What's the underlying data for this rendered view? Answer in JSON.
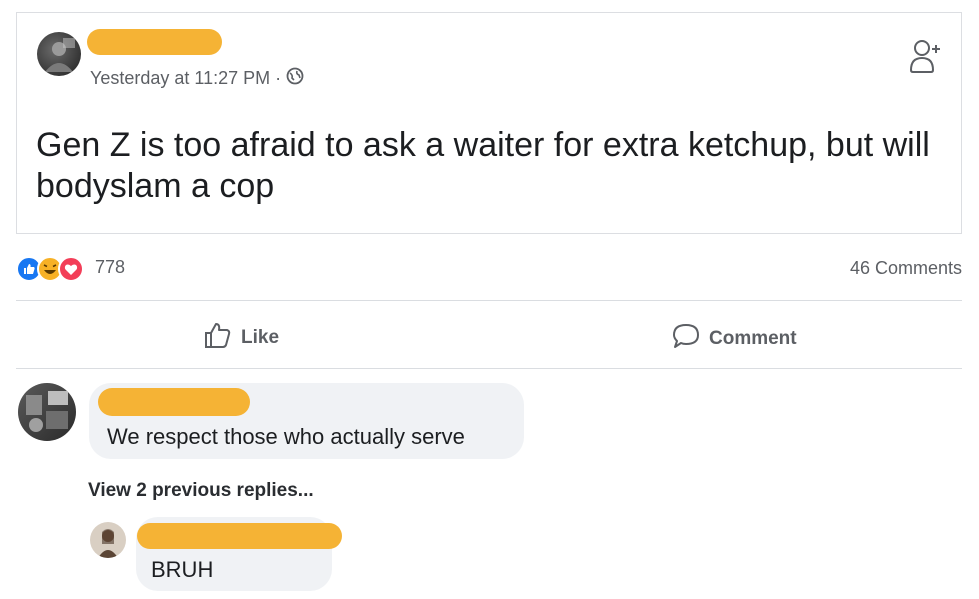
{
  "post": {
    "timestamp": "Yesterday at 11:27 PM",
    "separator": "·",
    "text": "Gen Z is too afraid to ask a waiter for extra ketchup, but will bodyslam a cop",
    "privacy_icon": "globe-icon",
    "add_friend_icon": "add-friend-icon"
  },
  "stats": {
    "reaction_count": "778",
    "reaction_icons": [
      "like-icon",
      "haha-icon",
      "love-icon"
    ],
    "comments_count": "46 Comments"
  },
  "actions": {
    "like_label": "Like",
    "comment_label": "Comment"
  },
  "comments": [
    {
      "text": "We respect those who actually serve"
    }
  ],
  "view_replies": "View 2 previous replies...",
  "replies": [
    {
      "text": "BRUH"
    }
  ],
  "colors": {
    "redaction": "#f5b335",
    "like_blue": "#1877f2",
    "love_red": "#f33e58",
    "haha_yellow": "#f7b125"
  }
}
